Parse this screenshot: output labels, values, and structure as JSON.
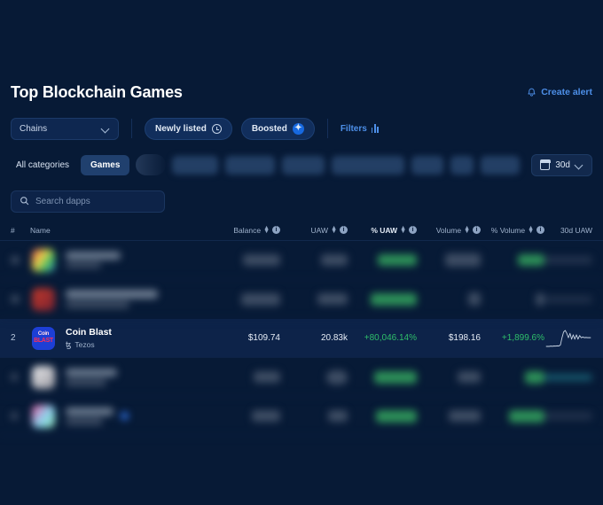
{
  "theme": {
    "bg": "#071a36",
    "accent": "#4d8fe8",
    "boost_blue": "#1769e0",
    "positive_green": "#2fbf6a",
    "row_highlight": "#0d2349"
  },
  "header": {
    "title": "Top Blockchain Games",
    "create_alert_label": "Create alert",
    "create_alert_icon": "bell-alert-icon"
  },
  "filters": {
    "chains_label": "Chains",
    "chains_icon": "chevron-down-icon",
    "newly_listed_label": "Newly listed",
    "newly_listed_icon": "clock-icon",
    "boosted_label": "Boosted",
    "boosted_icon": "boost-sparkle-icon",
    "filters_label": "Filters",
    "filters_icon": "sliders-icon"
  },
  "categories": {
    "all_label": "All categories",
    "active_label": "Games",
    "hidden_pills": [
      52,
      56,
      48,
      82,
      36,
      26,
      44
    ],
    "range_label": "30d",
    "range_icon": "calendar-icon",
    "range_chevron": "chevron-down-icon"
  },
  "search": {
    "placeholder": "Search dapps",
    "value": "",
    "icon": "search-icon"
  },
  "table": {
    "columns": [
      {
        "key": "rank",
        "label": "#",
        "sortable": false,
        "info": false
      },
      {
        "key": "name",
        "label": "Name",
        "sortable": false,
        "info": false
      },
      {
        "key": "balance",
        "label": "Balance",
        "sortable": true,
        "info": true
      },
      {
        "key": "uaw",
        "label": "UAW",
        "sortable": true,
        "info": true
      },
      {
        "key": "puaw",
        "label": "% UAW",
        "sortable": true,
        "info": true
      },
      {
        "key": "volume",
        "label": "Volume",
        "sortable": true,
        "info": true
      },
      {
        "key": "pvolume",
        "label": "% Volume",
        "sortable": true,
        "info": true
      },
      {
        "key": "spark",
        "label": "30d UAW",
        "sortable": false,
        "info": false
      }
    ],
    "rows": [
      {
        "visible": false,
        "rank": "",
        "name": "",
        "chain": "",
        "balance": "",
        "uaw": "",
        "puaw": "",
        "volume": "",
        "pvolume": ""
      },
      {
        "visible": false,
        "rank": "",
        "name": "",
        "chain": "",
        "balance": "",
        "uaw": "",
        "puaw": "",
        "volume": "",
        "pvolume": ""
      },
      {
        "visible": true,
        "rank": "2",
        "name": "Coin Blast",
        "chain": "Tezos",
        "chain_icon": "tezos-icon",
        "app_icon_text_top": "Coin",
        "app_icon_text_bottom": "BLAST",
        "balance": "$109.74",
        "uaw": "20.83k",
        "puaw": "+80,046.14%",
        "volume": "$198.16",
        "pvolume": "+1,899.6%",
        "sparkline": [
          3,
          3,
          3,
          3.2,
          3.1,
          3.3,
          3.2,
          3.4,
          3.3,
          4,
          9,
          13,
          14,
          12,
          9,
          12,
          8,
          11,
          8,
          11,
          8,
          10.5,
          9,
          9.5,
          9,
          9.2,
          9,
          9,
          9
        ]
      },
      {
        "visible": false,
        "rank": "",
        "name": "",
        "chain": "",
        "balance": "",
        "uaw": "",
        "puaw": "",
        "volume": "",
        "pvolume": ""
      },
      {
        "visible": false,
        "rank": "",
        "name": "",
        "chain": "",
        "balance": "",
        "uaw": "",
        "puaw": "",
        "volume": "",
        "pvolume": ""
      }
    ]
  }
}
